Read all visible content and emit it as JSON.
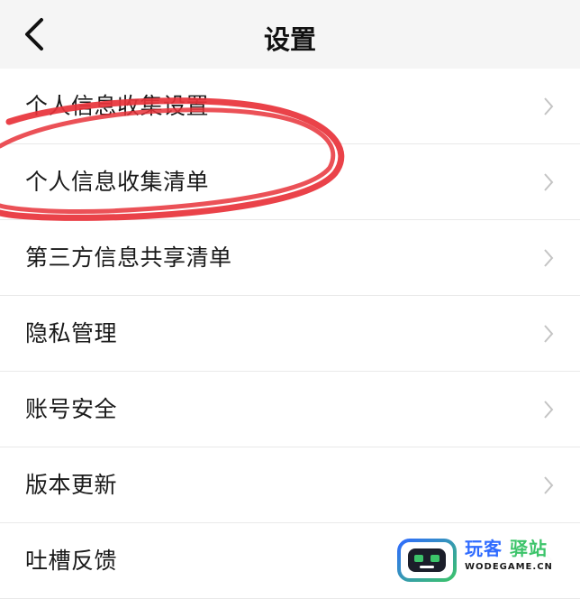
{
  "header": {
    "title": "设置",
    "back_icon": "chevron-left-icon"
  },
  "settings": {
    "items": [
      {
        "label": "个人信息收集设置"
      },
      {
        "label": "个人信息收集清单"
      },
      {
        "label": "第三方信息共享清单"
      },
      {
        "label": "隐私管理"
      },
      {
        "label": "账号安全"
      },
      {
        "label": "版本更新"
      },
      {
        "label": "吐槽反馈"
      }
    ],
    "chevron_icon": "chevron-right-icon"
  },
  "annotation": {
    "color": "#e8323a"
  },
  "watermark": {
    "name_part1": "玩客",
    "name_part2": "驿站",
    "domain": "WODEGAME.CN",
    "colors": {
      "blue": "#2f6bff",
      "green": "#3cc46a"
    }
  }
}
